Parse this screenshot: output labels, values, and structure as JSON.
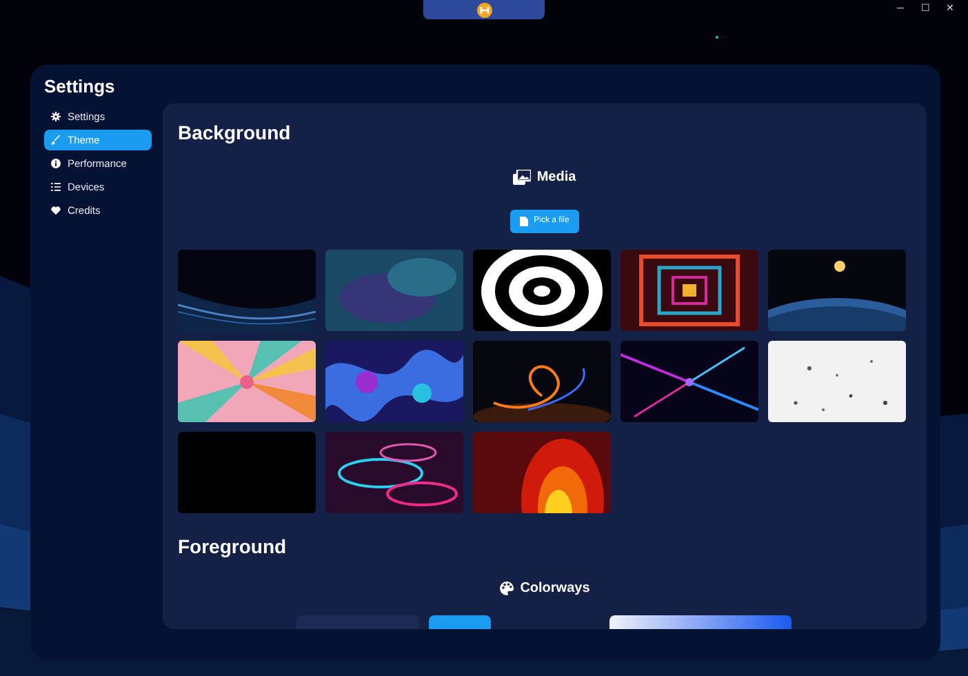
{
  "window": {
    "controls": [
      "─",
      "☐",
      "✕"
    ]
  },
  "title": "Settings",
  "sidebar": {
    "items": [
      {
        "label": "Settings",
        "kind": "gear",
        "selected": false
      },
      {
        "label": "Theme",
        "kind": "brush",
        "selected": true
      },
      {
        "label": "Performance",
        "kind": "info",
        "selected": false
      },
      {
        "label": "Devices",
        "kind": "list",
        "selected": false
      },
      {
        "label": "Credits",
        "kind": "heart",
        "selected": false
      }
    ]
  },
  "background": {
    "heading": "Background",
    "media_title": "Media",
    "pick_button": "Pick a file"
  },
  "foreground": {
    "heading": "Foreground",
    "colorways_title": "Colorways",
    "colorways": [
      {
        "kind": "dark"
      },
      {
        "kind": "accent"
      },
      {
        "kind": "gradient"
      }
    ]
  }
}
